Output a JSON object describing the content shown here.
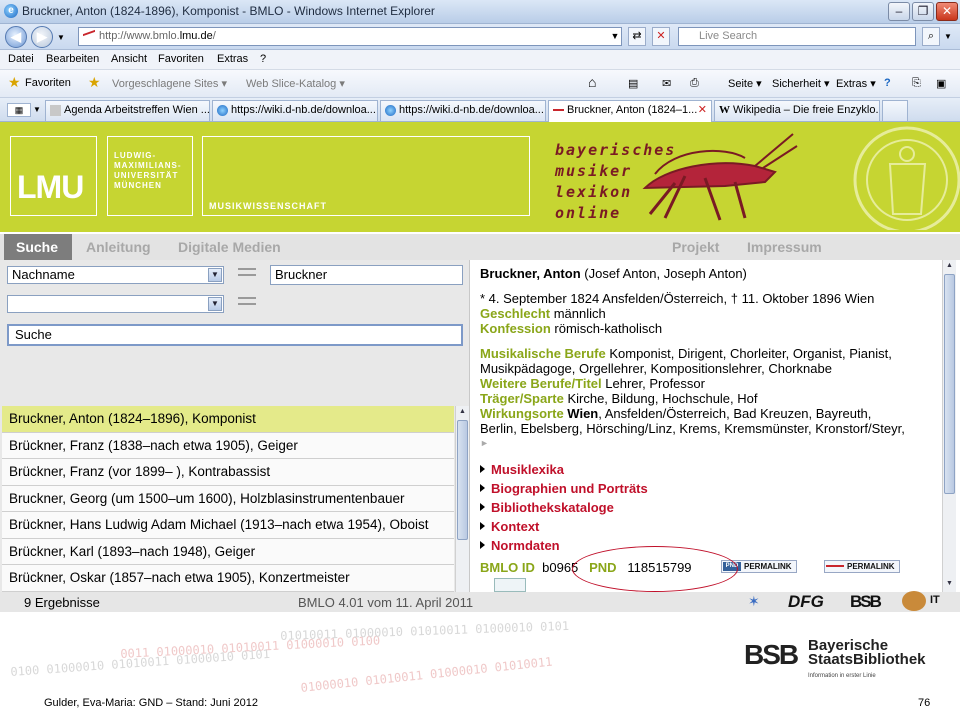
{
  "browser": {
    "title": "Bruckner, Anton (1824-1896), Komponist - BMLO - Windows Internet Explorer",
    "url_prefix": "http://www.bmlo.",
    "url_domain": "lmu.de",
    "url_suffix": "/",
    "search_placeholder": "Live Search",
    "menu": [
      "Datei",
      "Bearbeiten",
      "Ansicht",
      "Favoriten",
      "Extras",
      "?"
    ],
    "favorites_label": "Favoriten",
    "fav_links": [
      "Vorgeschlagene Sites ▾",
      "Web Slice-Katalog ▾"
    ],
    "cmd": [
      "Seite ▾",
      "Sicherheit ▾",
      "Extras ▾"
    ],
    "tabs": [
      {
        "label": "Agenda Arbeitstreffen Wien ..."
      },
      {
        "label": "https://wiki.d-nb.de/downloa..."
      },
      {
        "label": "https://wiki.d-nb.de/downloa..."
      },
      {
        "label": "Bruckner, Anton (1824–1..."
      },
      {
        "label": "Wikipedia – Die freie Enzyklo..."
      }
    ]
  },
  "header": {
    "lmu": "LMU",
    "uni_lines": [
      "LUDWIG-",
      "MAXIMILIANS-",
      "UNIVERSITÄT",
      "MÜNCHEN"
    ],
    "dept": "MUSIKWISSENSCHAFT",
    "bmlo_lines": [
      "bayerisches",
      "musiker",
      "lexikon",
      "online"
    ]
  },
  "nav": {
    "active": "Suche",
    "left": [
      "Anleitung",
      "Digitale Medien"
    ],
    "right": [
      "Projekt",
      "Impressum"
    ]
  },
  "search": {
    "field1": "Nachname",
    "value1": "Bruckner",
    "field2": "",
    "value2": "",
    "button": "Suche"
  },
  "results": [
    "Bruckner, Anton (1824–1896), Komponist",
    "Brückner, Franz (1838–nach etwa 1905), Geiger",
    "Brückner, Franz (vor 1899–    ), Kontrabassist",
    "Bruckner, Georg (um 1500–um 1600), Holzblasinstrumentenbauer",
    "Brückner, Hans Ludwig Adam Michael (1913–nach etwa 1954), Oboist",
    "Brückner, Karl (1893–nach 1948), Geiger",
    "Brückner, Oskar (1857–nach etwa 1905), Konzertmeister"
  ],
  "detail": {
    "name": "Bruckner, Anton",
    "alt": " (Josef Anton, Joseph Anton)",
    "life": "* 4. September 1824 Ansfelden/Österreich, † 11. Oktober 1896 Wien",
    "gender_label": "Geschlecht",
    "gender": "männlich",
    "conf_label": "Konfession",
    "conf": "römisch-katholisch",
    "mus_label": "Musikalische Berufe",
    "mus_1": "Komponist, Dirigent, Chorleiter, Organist, Pianist,",
    "mus_2": "Musikpädagoge, Orgellehrer, Kompositionslehrer, Chorknabe",
    "other_label": "Weitere Berufe/Titel",
    "other": "Lehrer, Professor",
    "carrier_label": "Träger/Sparte",
    "carrier": "Kirche, Bildung, Hochschule, Hof",
    "places_label": "Wirkungsorte",
    "places_bold": "Wien",
    "places_1": ", Ansfelden/Österreich, Bad Kreuzen, Bayreuth,",
    "places_2": "Berlin, Ebelsberg, Hörsching/Linz, Krems, Kremsmünster, Kronstorf/Steyr,",
    "sections": [
      "Musiklexika",
      "Biographien und Porträts",
      "Bibliothekskataloge",
      "Kontext",
      "Normdaten"
    ],
    "bmlo_id_label": "BMLO ID",
    "bmlo_id": "b0965",
    "pnd_label": "PND",
    "pnd": "118515799",
    "perma_tag": "PND",
    "permalink": "PERMALINK"
  },
  "status": {
    "count": "9 Ergebnisse",
    "version": "BMLO 4.01 vom 11. April 2011"
  },
  "logos": [
    "DFG",
    "BSB",
    "IT"
  ],
  "slide": {
    "bsb": "BSB",
    "bsb_lines": [
      "Bayerische",
      "StaatsBibliothek"
    ],
    "bsb_sub": "Information in erster Linie",
    "footer": "Gulder, Eva-Maria: GND – Stand: Juni 2012",
    "page": "76",
    "binary": [
      "0100 01000010 01010011 01000010 0101",
      "0011 01000010 01010011 01000010 0100",
      "01010011 01000010 01010011 01000010 0101",
      "01000010 01010011 01000010 01010011"
    ]
  }
}
